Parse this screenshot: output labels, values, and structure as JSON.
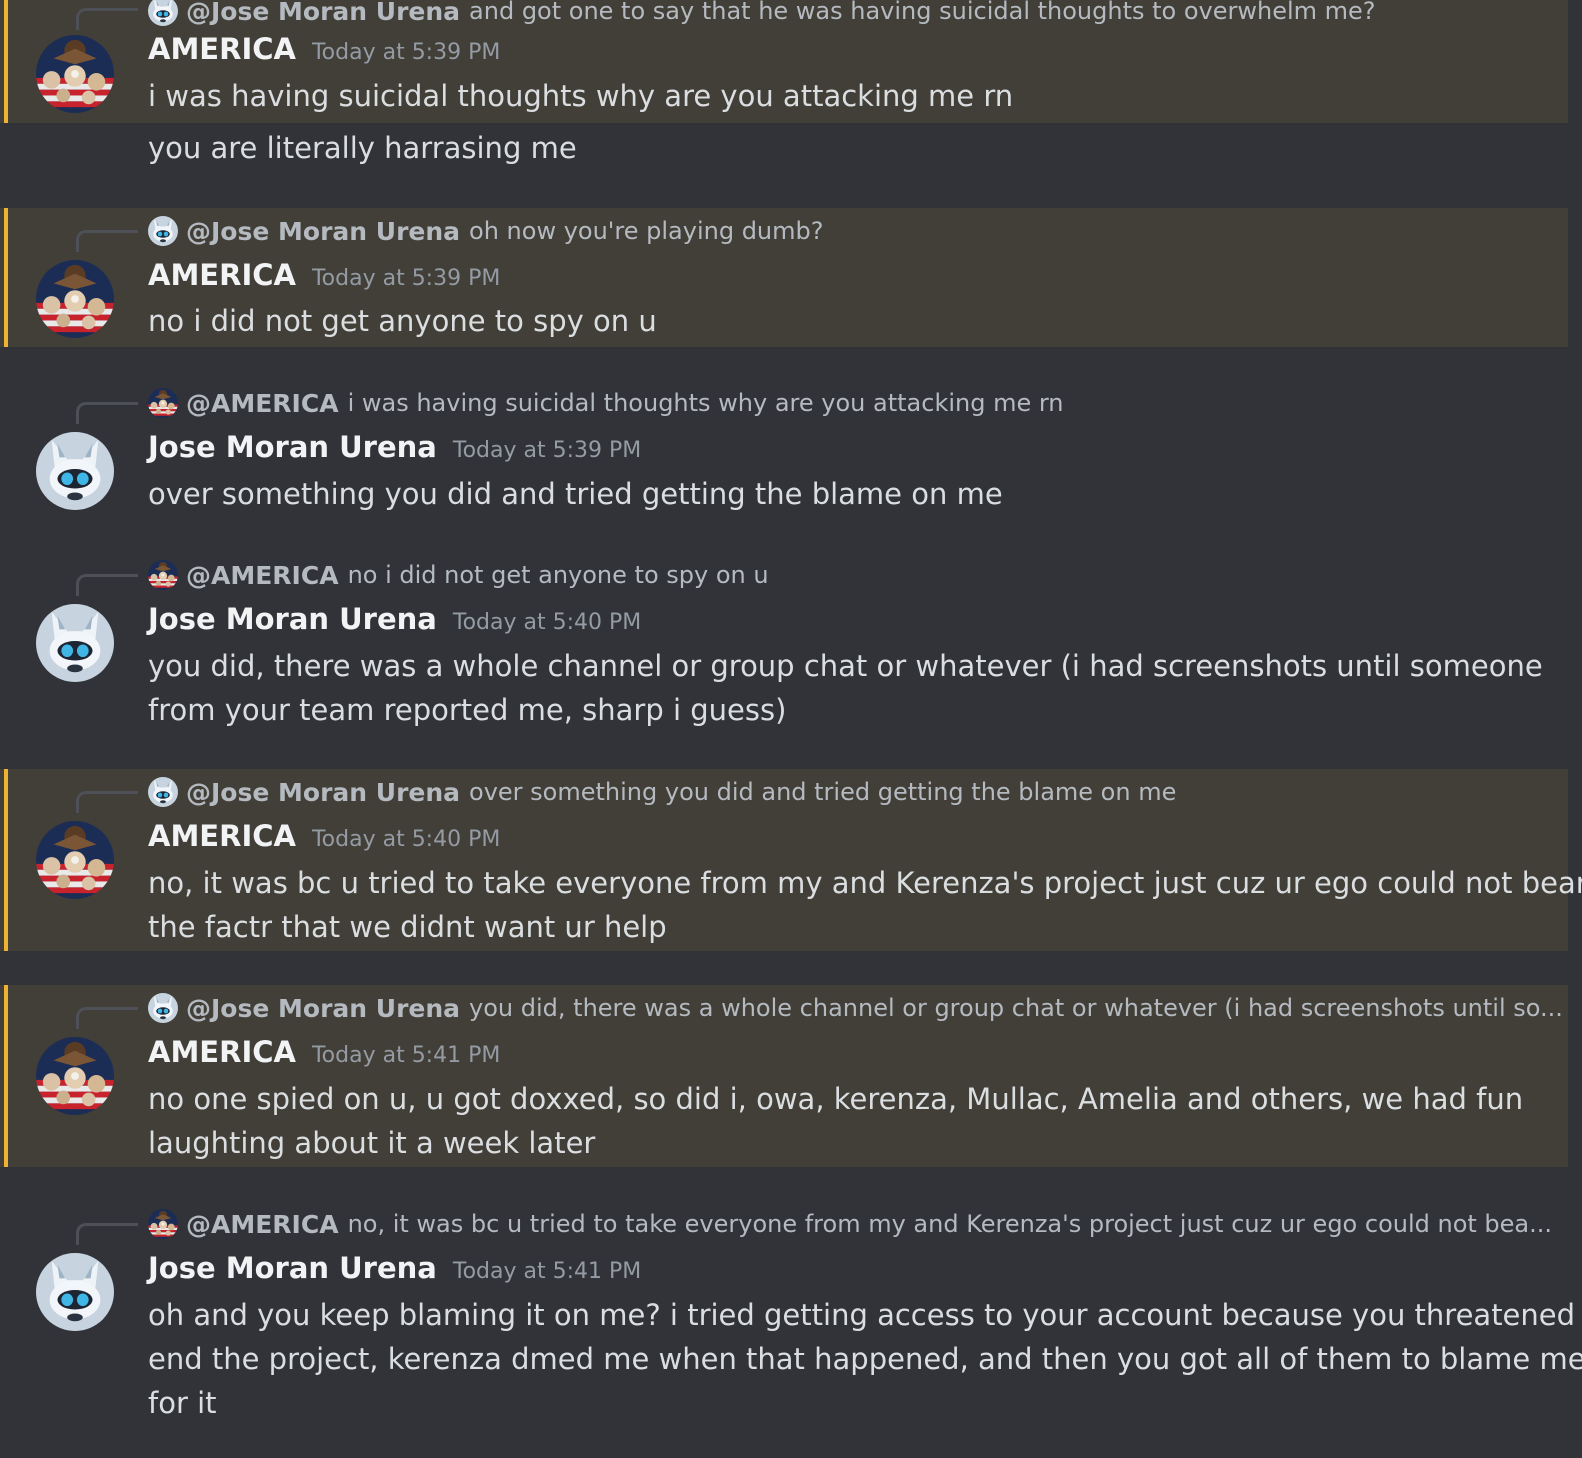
{
  "colors": {
    "background": "#313338",
    "mention_highlight": "#413f37",
    "mention_bar": "#f0b232",
    "author": "#f2f3f5",
    "timestamp": "#949ba4",
    "text": "#dbdee1"
  },
  "messages": [
    {
      "reply": {
        "name": "@Jose Moran Urena",
        "text": "and got one to say that he was having suicidal thoughts to overwhelm me?",
        "avatar_icon": "wolf-avatar-icon"
      },
      "author": "AMERICA",
      "timestamp": "Today at 5:39 PM",
      "lines": [
        "i was having suicidal thoughts why are you attacking me rn"
      ],
      "mention": true,
      "avatar_icon": "flag-collage-avatar-icon"
    },
    {
      "continuation": true,
      "lines": [
        "you are literally harrasing me"
      ]
    },
    {
      "reply": {
        "name": "@Jose Moran Urena",
        "text": "oh now you're playing dumb?",
        "avatar_icon": "wolf-avatar-icon"
      },
      "author": "AMERICA",
      "timestamp": "Today at 5:39 PM",
      "lines": [
        "no i did not get anyone to spy on u"
      ],
      "mention": true,
      "avatar_icon": "flag-collage-avatar-icon"
    },
    {
      "reply": {
        "name": "@AMERICA",
        "text": "i was having suicidal thoughts why are you attacking me rn",
        "avatar_icon": "flag-collage-avatar-icon"
      },
      "author": "Jose Moran Urena",
      "timestamp": "Today at 5:39 PM",
      "lines": [
        "over something you did and tried getting the blame on me"
      ],
      "mention": false,
      "avatar_icon": "wolf-avatar-icon"
    },
    {
      "reply": {
        "name": "@AMERICA",
        "text": "no i did not get anyone to spy on u",
        "avatar_icon": "flag-collage-avatar-icon"
      },
      "author": "Jose Moran Urena",
      "timestamp": "Today at 5:40 PM",
      "lines": [
        "you did, there was a whole channel or group chat or whatever (i had screenshots until someone",
        "from your team reported me, sharp i guess)"
      ],
      "mention": false,
      "avatar_icon": "wolf-avatar-icon"
    },
    {
      "reply": {
        "name": "@Jose Moran Urena",
        "text": "over something you did and tried getting the blame on me",
        "avatar_icon": "wolf-avatar-icon"
      },
      "author": "AMERICA",
      "timestamp": "Today at 5:40 PM",
      "lines": [
        "no, it was bc u tried to take everyone from my and Kerenza's project just cuz ur ego could not bear",
        "the factr that we didnt want ur help"
      ],
      "mention": true,
      "avatar_icon": "flag-collage-avatar-icon"
    },
    {
      "reply": {
        "name": "@Jose Moran Urena",
        "text": "you did, there was a whole channel or group chat or whatever (i had screenshots until so...",
        "avatar_icon": "wolf-avatar-icon"
      },
      "author": "AMERICA",
      "timestamp": "Today at 5:41 PM",
      "lines": [
        "no one spied on u, u got doxxed, so did i, owa, kerenza, Mullac, Amelia and others, we had fun",
        "laughting about it a week later"
      ],
      "mention": true,
      "avatar_icon": "flag-collage-avatar-icon"
    },
    {
      "reply": {
        "name": "@AMERICA",
        "text": "no, it was bc u tried to take everyone from my and Kerenza's project just cuz ur ego could not bea...",
        "avatar_icon": "flag-collage-avatar-icon"
      },
      "author": "Jose Moran Urena",
      "timestamp": "Today at 5:41 PM",
      "lines": [
        "oh and you keep blaming it on me? i tried getting access to your account because you threatened to",
        "end the project, kerenza dmed me when that happened, and then you got all of them to blame me",
        "for it"
      ],
      "mention": false,
      "avatar_icon": "wolf-avatar-icon"
    }
  ]
}
